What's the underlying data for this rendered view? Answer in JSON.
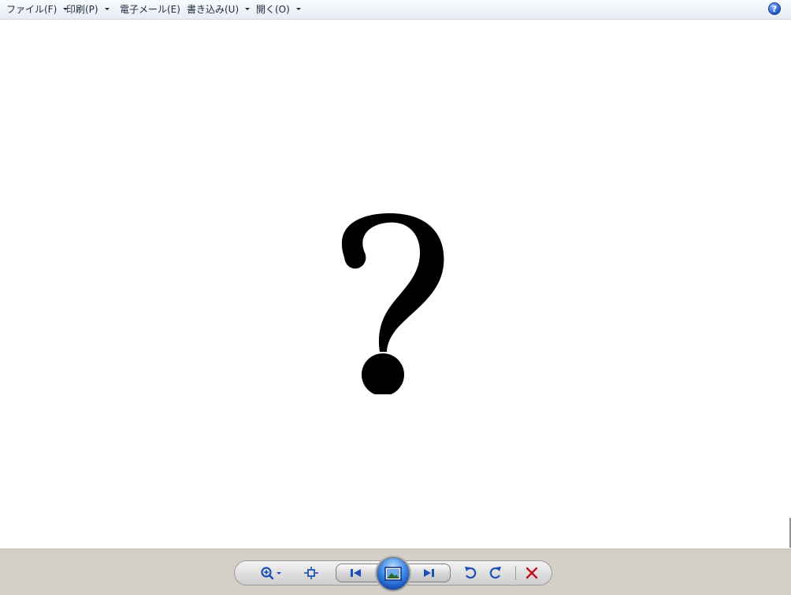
{
  "menu": {
    "items": [
      {
        "label": "ファイル(F)"
      },
      {
        "label": "印刷(P)"
      },
      {
        "label": "電子メール(E)"
      },
      {
        "label": "書き込み(U)"
      },
      {
        "label": "開く(O)"
      }
    ],
    "help_label": "?"
  },
  "viewer": {
    "image_glyph": "?"
  },
  "controls": {
    "icons": [
      "zoom-icon",
      "actual-size-icon",
      "previous-icon",
      "slideshow-icon",
      "next-icon",
      "rotate-counterclockwise-icon",
      "rotate-clockwise-icon",
      "delete-icon"
    ]
  },
  "colors": {
    "menubar_top": "#f9fbfd",
    "menubar_bottom": "#e6ecf4",
    "control_blue": "#1f4fb4",
    "delete_red": "#c1121f",
    "bottom_bar": "#d4d0c8"
  }
}
